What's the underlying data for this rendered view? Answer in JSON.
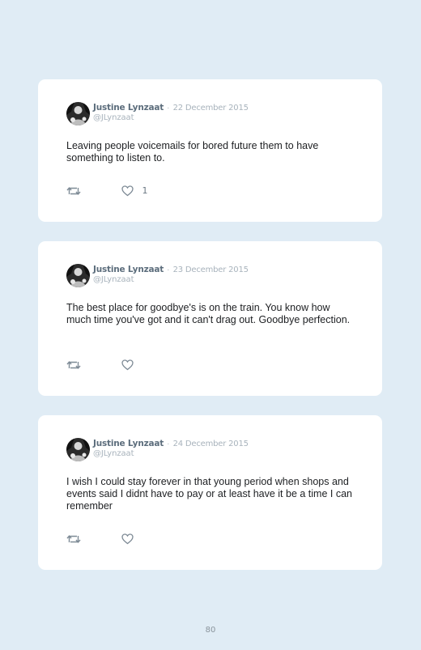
{
  "tweets": [
    {
      "author_name": "Justine Lynzaat",
      "separator": "·",
      "date": "22 December 2015",
      "handle": "@JLynzaat",
      "text": "Leaving people voicemails for bored future them to have something to listen to.",
      "like_count": "1",
      "avatar_icon": "avatar-photo"
    },
    {
      "author_name": "Justine Lynzaat",
      "separator": "·",
      "date": "23 December 2015",
      "handle": "@JLynzaat",
      "text": "The best place for goodbye's is on the train. You know how much time you've got and it can't drag out. Goodbye perfection.",
      "like_count": "",
      "avatar_icon": "avatar-photo"
    },
    {
      "author_name": "Justine Lynzaat",
      "separator": "·",
      "date": "24 December 2015",
      "handle": "@JLynzaat",
      "text": "I wish I could stay forever in that young period when shops and events said I didnt have to pay or at least have it be a time I can remember",
      "like_count": "",
      "avatar_icon": "avatar-photo"
    }
  ],
  "icons": {
    "retweet": "retweet-icon",
    "like": "heart-icon"
  },
  "colors": {
    "background": "#e0ecf5",
    "card": "#ffffff",
    "author": "#5c6d7c",
    "meta": "#a8b3bc",
    "text": "#1d1f22"
  },
  "page": {
    "number": "80"
  }
}
